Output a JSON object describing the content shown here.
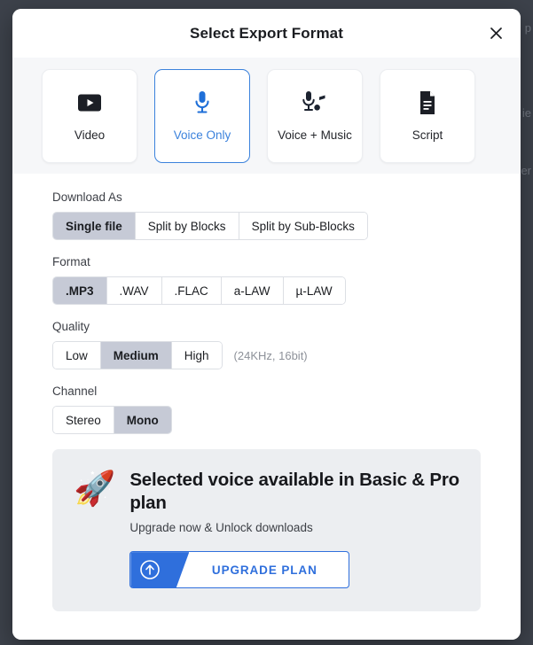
{
  "background": {
    "scrim_color": "#3d424b",
    "hidden_texts": [
      "p",
      "ie",
      "er"
    ]
  },
  "dialog": {
    "title": "Select Export Format",
    "close_icon": "close-icon",
    "accent_color": "#2f6fdc",
    "format_cards": [
      {
        "label": "Video",
        "icon": "video-play-icon",
        "selected": false
      },
      {
        "label": "Voice Only",
        "icon": "microphone-icon",
        "selected": true
      },
      {
        "label": "Voice + Music",
        "icon": "microphone-music-note-icon",
        "selected": false
      },
      {
        "label": "Script",
        "icon": "document-text-icon",
        "selected": false
      }
    ],
    "sections": [
      {
        "key": "download_as",
        "label": "Download As",
        "options": [
          "Single file",
          "Split by Blocks",
          "Split by Sub-Blocks"
        ],
        "selected": "Single file",
        "hint": ""
      },
      {
        "key": "format",
        "label": "Format",
        "options": [
          ".MP3",
          ".WAV",
          ".FLAC",
          "a-LAW",
          "µ-LAW"
        ],
        "selected": ".MP3",
        "hint": ""
      },
      {
        "key": "quality",
        "label": "Quality",
        "options": [
          "Low",
          "Medium",
          "High"
        ],
        "selected": "Medium",
        "hint": "(24KHz, 16bit)"
      },
      {
        "key": "channel",
        "label": "Channel",
        "options": [
          "Stereo",
          "Mono"
        ],
        "selected": "Mono",
        "hint": ""
      }
    ],
    "banner": {
      "icon": "rocket-icon",
      "emoji": "🚀",
      "title": "Selected voice available in Basic & Pro plan",
      "subtitle": "Upgrade now & Unlock downloads",
      "button_label": "UPGRADE PLAN",
      "button_icon": "arrow-up-circle-icon"
    }
  }
}
